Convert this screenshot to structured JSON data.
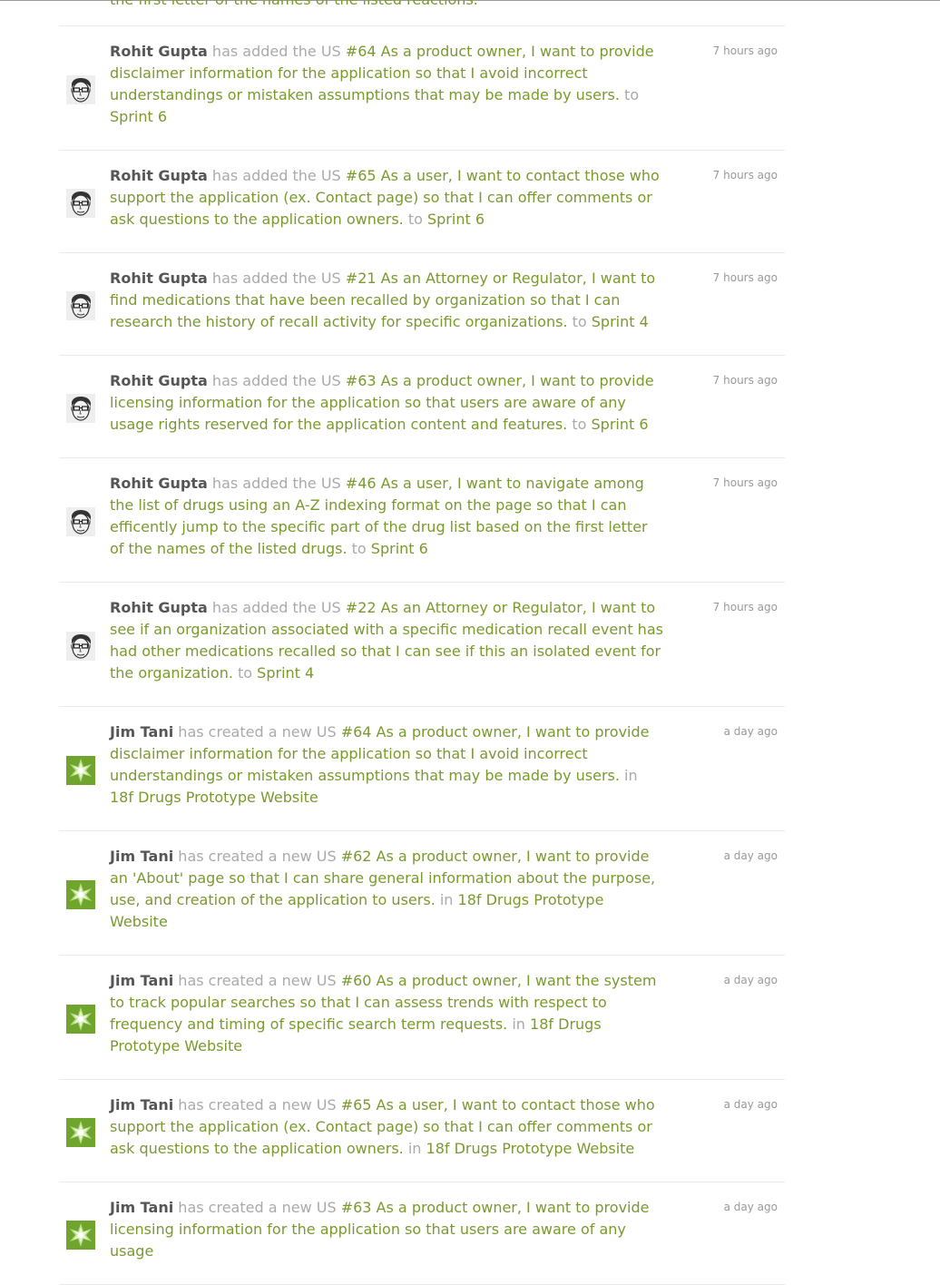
{
  "colors": {
    "link": "#7a9a2e",
    "user": "#555555",
    "muted": "#aaaaaa",
    "time": "#999999"
  },
  "feed": {
    "partial_entry": {
      "tail": "the first letter of the names of the listed reactions."
    },
    "entries": [
      {
        "avatar": "sketch-face-avatar-icon",
        "user": "Rohit Gupta",
        "action": "has added the US",
        "story": "#64 As a product owner, I want to provide disclaimer information for the application so that I avoid incorrect understandings or mistaken assumptions that may be made by users.",
        "prep": "to",
        "target": "Sprint 6",
        "time": "7 hours ago"
      },
      {
        "avatar": "sketch-face-avatar-icon",
        "user": "Rohit Gupta",
        "action": "has added the US",
        "story": "#65 As a user, I want to contact those who support the application (ex. Contact page) so that I can offer comments or ask questions to the application owners.",
        "prep": "to",
        "target": "Sprint 6",
        "time": "7 hours ago"
      },
      {
        "avatar": "sketch-face-avatar-icon",
        "user": "Rohit Gupta",
        "action": "has added the US",
        "story": "#21 As an Attorney or Regulator, I want to find medications that have been recalled by organization so that I can research the history of recall activity for specific organizations.",
        "prep": "to",
        "target": "Sprint 4",
        "time": "7 hours ago"
      },
      {
        "avatar": "sketch-face-avatar-icon",
        "user": "Rohit Gupta",
        "action": "has added the US",
        "story": "#63 As a product owner, I want to provide licensing information for the application so that users are aware of any usage rights reserved for the application content and features.",
        "prep": "to",
        "target": "Sprint 6",
        "time": "7 hours ago"
      },
      {
        "avatar": "sketch-face-avatar-icon",
        "user": "Rohit Gupta",
        "action": "has added the US",
        "story": "#46 As a user, I want to navigate among the list of drugs using an A-Z indexing format on the page so that I can efficently jump to the specific part of the drug list based on the first letter of the names of the listed drugs.",
        "prep": "to",
        "target": "Sprint 6",
        "time": "7 hours ago"
      },
      {
        "avatar": "sketch-face-avatar-icon",
        "user": "Rohit Gupta",
        "action": "has added the US",
        "story": "#22 As an Attorney or Regulator, I want to see if an organization associated with a specific medication recall event has had other medications recalled so that I can see if this an isolated event for the organization.",
        "prep": "to",
        "target": "Sprint 4",
        "time": "7 hours ago"
      },
      {
        "avatar": "green-star-avatar-icon",
        "user": "Jim Tani",
        "action": "has created a new US",
        "story": "#64 As a product owner, I want to provide disclaimer information for the application so that I avoid incorrect understandings or mistaken assumptions that may be made by users.",
        "prep": "in",
        "target": "18f Drugs Prototype Website",
        "time": "a day ago"
      },
      {
        "avatar": "green-star-avatar-icon",
        "user": "Jim Tani",
        "action": "has created a new US",
        "story": "#62 As a product owner, I want to provide an 'About' page so that I can share general information about the purpose, use, and creation of the application to users.",
        "prep": "in",
        "target": "18f Drugs Prototype Website",
        "time": "a day ago"
      },
      {
        "avatar": "green-star-avatar-icon",
        "user": "Jim Tani",
        "action": "has created a new US",
        "story": "#60 As a product owner, I want the system to track popular searches so that I can assess trends with respect to frequency and timing of specific search term requests.",
        "prep": "in",
        "target": "18f Drugs Prototype Website",
        "time": "a day ago"
      },
      {
        "avatar": "green-star-avatar-icon",
        "user": "Jim Tani",
        "action": "has created a new US",
        "story": "#65 As a user, I want to contact those who support the application (ex. Contact page) so that I can offer comments or ask questions to the application owners.",
        "prep": "in",
        "target": "18f Drugs Prototype Website",
        "time": "a day ago"
      },
      {
        "avatar": "green-star-avatar-icon",
        "user": "Jim Tani",
        "action": "has created a new US",
        "story": "#63 As a product owner, I want to provide licensing information for the application so that users are aware of any usage",
        "prep": "",
        "target": "",
        "time": "a day ago"
      }
    ]
  }
}
